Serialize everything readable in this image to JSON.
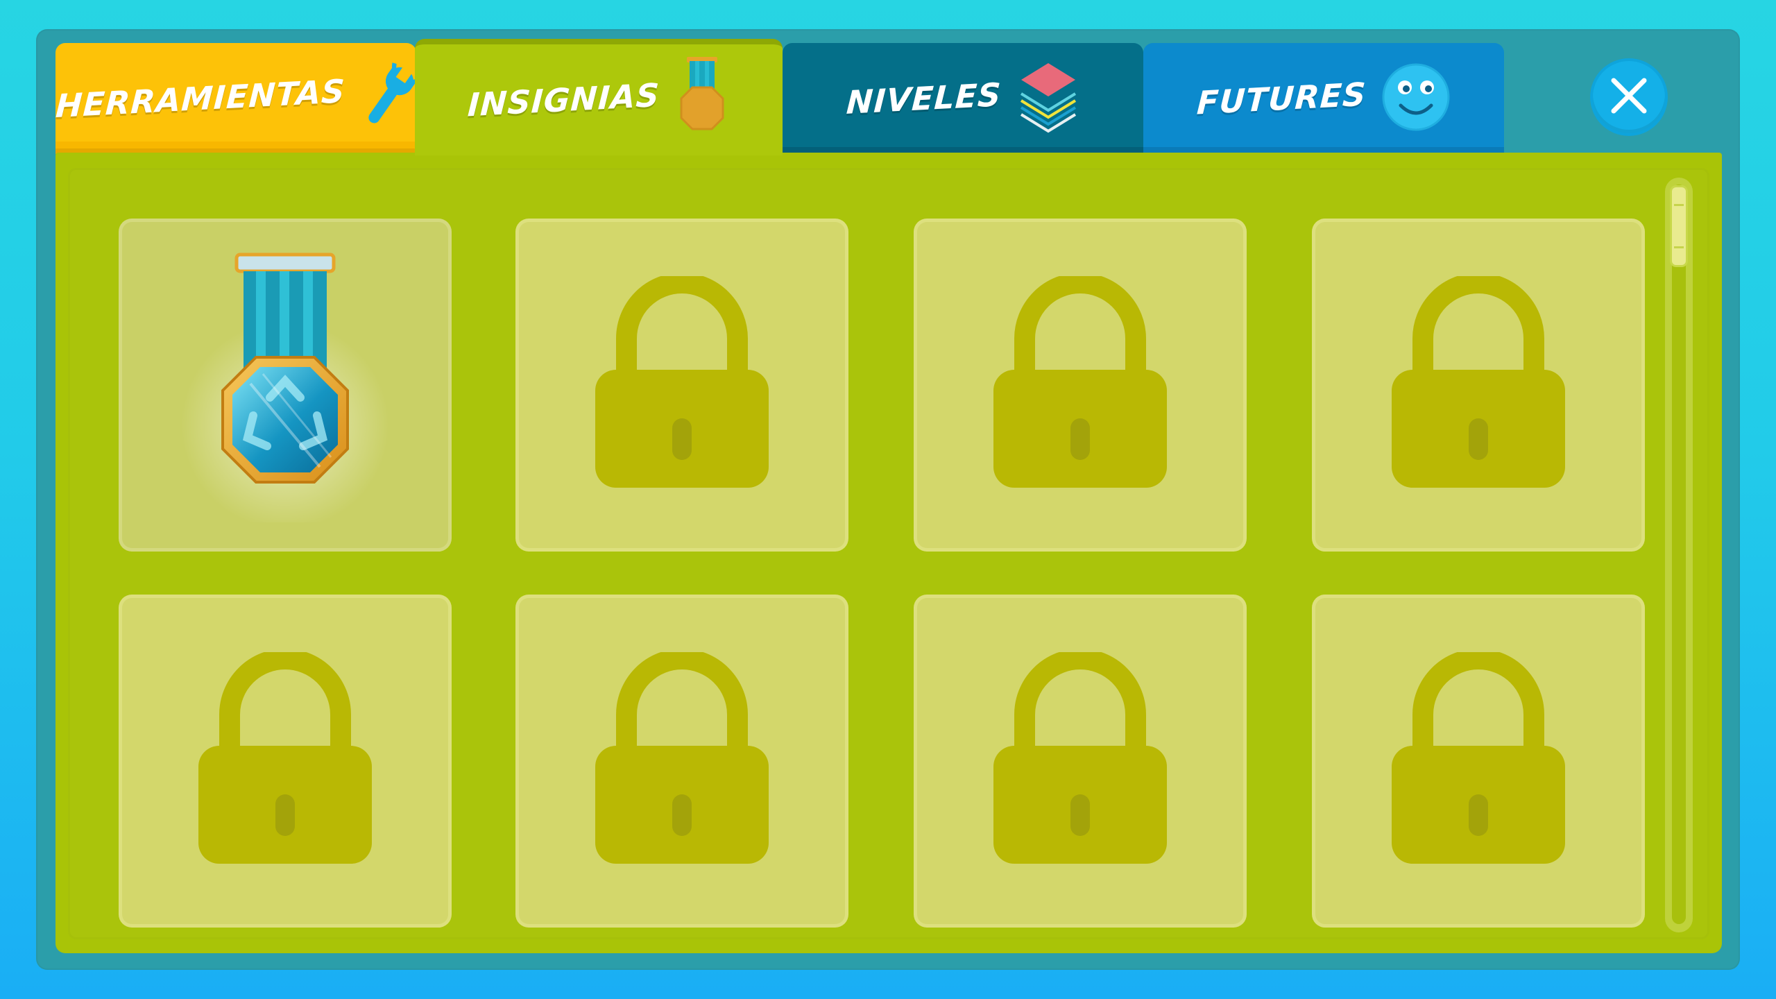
{
  "tabs": [
    {
      "label": "HERRAMIENTAS",
      "icon": "wrench-icon",
      "color": "#fdc208"
    },
    {
      "label": "INSIGNIAS",
      "icon": "medal-icon",
      "color": "#adc80b",
      "active": true
    },
    {
      "label": "NIVELES",
      "icon": "layers-icon",
      "color": "#046f89"
    },
    {
      "label": "FUTURES",
      "icon": "smiley-icon",
      "color": "#0c8acd"
    }
  ],
  "close": {
    "icon": "close-icon"
  },
  "badges": [
    {
      "state": "unlocked",
      "icon": "recycle-medal-icon"
    },
    {
      "state": "locked",
      "icon": "lock-icon"
    },
    {
      "state": "locked",
      "icon": "lock-icon"
    },
    {
      "state": "locked",
      "icon": "lock-icon"
    },
    {
      "state": "locked",
      "icon": "lock-icon"
    },
    {
      "state": "locked",
      "icon": "lock-icon"
    },
    {
      "state": "locked",
      "icon": "lock-icon"
    },
    {
      "state": "locked",
      "icon": "lock-icon"
    }
  ],
  "colors": {
    "panel": "#a9c407",
    "slot": "#d3d76b",
    "lock": "#b9b804",
    "frame": "#2b9eaa"
  }
}
